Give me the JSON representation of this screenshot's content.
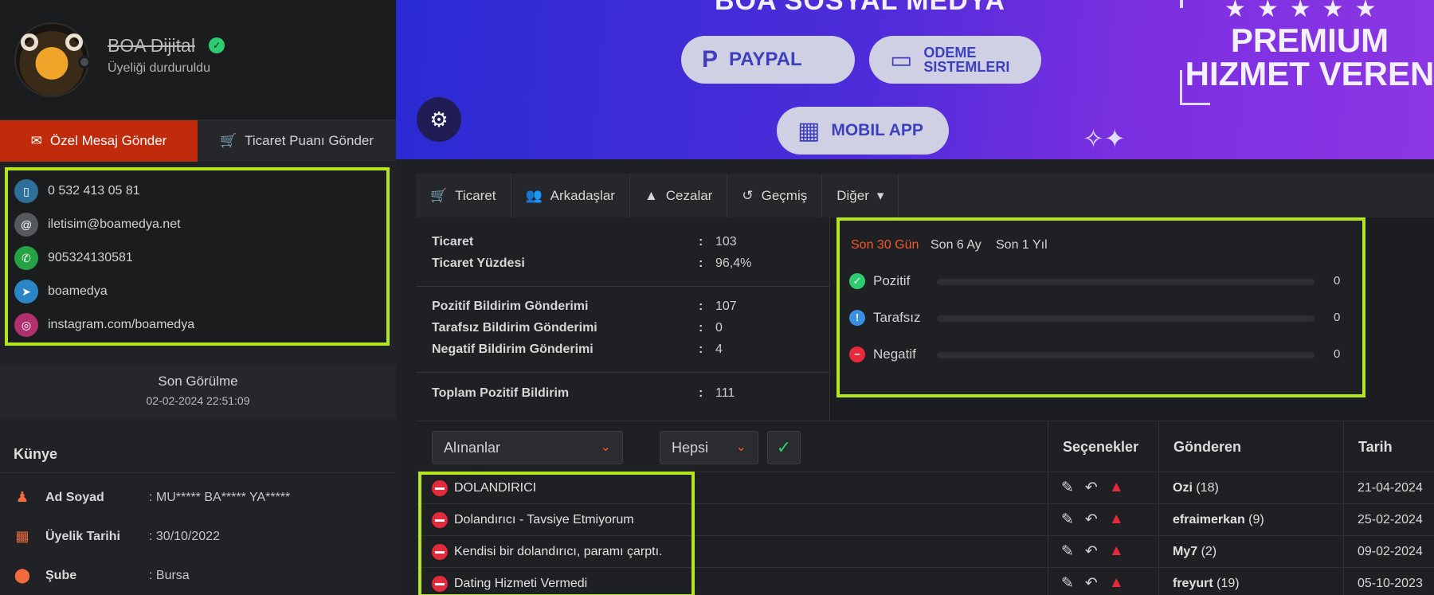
{
  "profile": {
    "name": "BOA Dijital",
    "status": "Üyeliği durduruldu",
    "verified_icon": "✓"
  },
  "actions": {
    "message_label": "Özel Mesaj Gönder",
    "trade_label": "Ticaret Puanı Gönder"
  },
  "contacts": [
    {
      "icon": "phone-icon",
      "glyph": "▯",
      "color": "#2e6f9a",
      "text": "0 532 413 05 81"
    },
    {
      "icon": "email-icon",
      "glyph": "@",
      "color": "#55585d",
      "text": "iletisim@boamedya.net"
    },
    {
      "icon": "whatsapp-icon",
      "glyph": "✆",
      "color": "#25a244",
      "text": "905324130581"
    },
    {
      "icon": "telegram-icon",
      "glyph": "➤",
      "color": "#2b86c5",
      "text": "boamedya"
    },
    {
      "icon": "instagram-icon",
      "glyph": "◎",
      "color": "#b1306e",
      "text": "instagram.com/boamedya"
    }
  ],
  "last_seen": {
    "title": "Son Görülme",
    "date": "02-02-2024 22:51:09"
  },
  "kunye": {
    "title": "Künye",
    "rows": [
      {
        "icon": "person-icon",
        "label": "Ad Soyad",
        "value": ": MU***** BA***** YA*****"
      },
      {
        "icon": "calendar-icon",
        "label": "Üyelik Tarihi",
        "value": ": 30/10/2022"
      },
      {
        "icon": "location-icon",
        "label": "Şube",
        "value": ": Bursa"
      }
    ]
  },
  "banner": {
    "title": "BOA SOSYAL MEDYA",
    "paypal": "PAYPAL",
    "odeme_line1": "ODEME",
    "odeme_line2": "SISTEMLERI",
    "mobil": "MOBIL APP",
    "premium_line1": "PREMIUM",
    "premium_line2": "HIZMET VEREN"
  },
  "tabs": [
    {
      "icon": "cart-icon",
      "glyph": "🛒",
      "label": "Ticaret"
    },
    {
      "icon": "users-icon",
      "glyph": "👥",
      "label": "Arkadaşlar"
    },
    {
      "icon": "warning-icon",
      "glyph": "▲",
      "label": "Cezalar"
    },
    {
      "icon": "history-icon",
      "glyph": "↺",
      "label": "Geçmiş"
    },
    {
      "icon": "caret-down-icon",
      "glyph": "▾",
      "label": "Diğer"
    }
  ],
  "stats": [
    {
      "label": "Ticaret",
      "value": "103"
    },
    {
      "label": "Ticaret Yüzdesi",
      "value": "96,4%"
    },
    {
      "label": "Pozitif Bildirim Gönderimi",
      "value": "107"
    },
    {
      "label": "Tarafsız Bildirim Gönderimi",
      "value": "0"
    },
    {
      "label": "Negatif Bildirim Gönderimi",
      "value": "4"
    },
    {
      "label": "Toplam Pozitif Bildirim",
      "value": "111"
    }
  ],
  "periods": {
    "tabs": [
      "Son 30 Gün",
      "Son 6 Ay",
      "Son 1 Yıl"
    ],
    "active": "Son 30 Gün",
    "rows": [
      {
        "label": "Pozitif",
        "value": "0",
        "fraction": 0,
        "color": "#2ecc71",
        "glyph": "✓"
      },
      {
        "label": "Tarafsız",
        "value": "0",
        "fraction": 0,
        "color": "#3a8ee6",
        "glyph": "!"
      },
      {
        "label": "Negatif",
        "value": "0",
        "fraction": 0,
        "color": "#e8283c",
        "glyph": "−"
      }
    ]
  },
  "filters": {
    "received": "Alınanlar",
    "all": "Hepsi"
  },
  "table": {
    "headers": {
      "options": "Seçenekler",
      "sender": "Gönderen",
      "date": "Tarih"
    },
    "rows": [
      {
        "text": "DOLANDIRICI",
        "sender": "Ozi",
        "count": "(18)",
        "date": "21-04-2024"
      },
      {
        "text": "Dolandırıcı - Tavsiye Etmiyorum",
        "sender": "efraimerkan",
        "count": "(9)",
        "date": "25-02-2024"
      },
      {
        "text": "Kendisi bir dolandırıcı, paramı çarptı.",
        "sender": "My7",
        "count": "(2)",
        "date": "09-02-2024"
      },
      {
        "text": "Dating Hizmeti Vermedi",
        "sender": "freyurt",
        "count": "(19)",
        "date": "05-10-2023"
      }
    ]
  }
}
